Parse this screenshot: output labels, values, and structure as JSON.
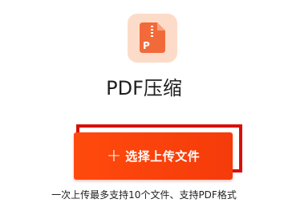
{
  "tool": {
    "icon": "pdf-compress-file-icon",
    "icon_letter": "P",
    "title": "PDF压缩"
  },
  "upload": {
    "button_icon": "plus-icon",
    "plus_glyph": "+",
    "button_label": "选择上传文件"
  },
  "hint": "一次上传最多支持10个文件、支持PDF格式",
  "colors": {
    "accent": "#ff4a0d",
    "icon_tile_bg": "#fcdcc8",
    "icon_file": "#f26a3a",
    "highlight_border": "#d7100a"
  }
}
